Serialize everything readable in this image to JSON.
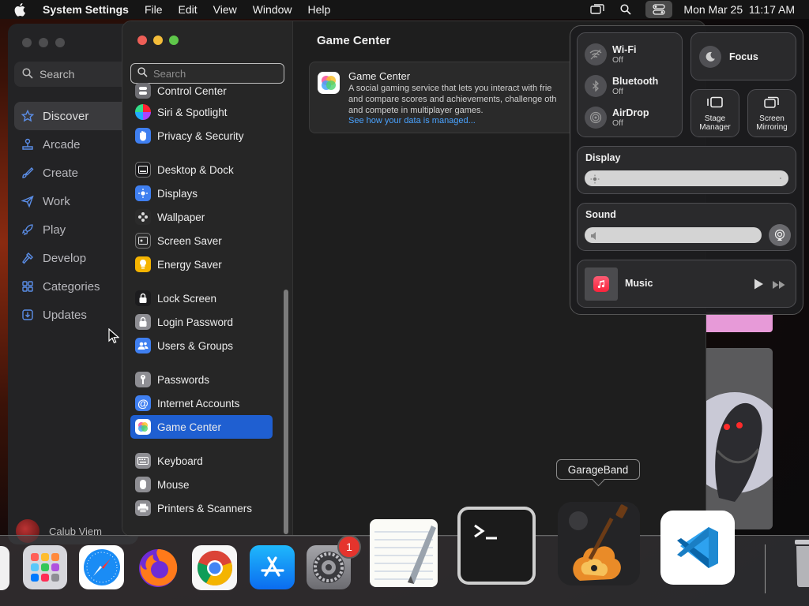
{
  "menubar": {
    "app_name": "System Settings",
    "menus": [
      "File",
      "Edit",
      "View",
      "Window",
      "Help"
    ],
    "datetime": "Mon Mar 25  11:17 AM"
  },
  "appstore": {
    "search_placeholder": "Search",
    "nav": [
      {
        "label": "Discover",
        "icon": "star-icon",
        "active": true
      },
      {
        "label": "Arcade",
        "icon": "joystick-icon"
      },
      {
        "label": "Create",
        "icon": "brush-icon"
      },
      {
        "label": "Work",
        "icon": "paperplane-icon"
      },
      {
        "label": "Play",
        "icon": "rocket-icon"
      },
      {
        "label": "Develop",
        "icon": "hammer-icon"
      },
      {
        "label": "Categories",
        "icon": "grid-icon"
      },
      {
        "label": "Updates",
        "icon": "download-icon"
      }
    ],
    "user_name": "Calub Viem"
  },
  "settings": {
    "search_placeholder": "Search",
    "sidebar": [
      {
        "label": "Control Center",
        "color": "#6e6e73"
      },
      {
        "label": "Siri & Spotlight",
        "color": "#a64de0"
      },
      {
        "label": "Privacy & Security",
        "color": "#3f7ff0"
      },
      {
        "label": "Desktop & Dock",
        "color": "#1c1c1e"
      },
      {
        "label": "Displays",
        "color": "#3f7ff0"
      },
      {
        "label": "Wallpaper",
        "color": "#2b8fe8"
      },
      {
        "label": "Screen Saver",
        "color": "#46c2f0"
      },
      {
        "label": "Energy Saver",
        "color": "#f5b400"
      },
      {
        "label": "Lock Screen",
        "color": "#1c1c1e"
      },
      {
        "label": "Login Password",
        "color": "#8e8e93"
      },
      {
        "label": "Users & Groups",
        "color": "#3f7ff0"
      },
      {
        "label": "Passwords",
        "color": "#8e8e93"
      },
      {
        "label": "Internet Accounts",
        "color": "#3f7ff0"
      },
      {
        "label": "Game Center",
        "color": "#ffffff",
        "selected": true
      },
      {
        "label": "Keyboard",
        "color": "#8e8e93"
      },
      {
        "label": "Mouse",
        "color": "#8e8e93"
      },
      {
        "label": "Printers & Scanners",
        "color": "#8e8e93"
      }
    ],
    "content": {
      "title": "Game Center",
      "card_title": "Game Center",
      "description_lines": [
        "A social gaming service that lets you interact with frie",
        "and compare scores and achievements, challenge oth",
        "and compete in multiplayer games."
      ],
      "link": "See how your data is managed..."
    }
  },
  "control_center": {
    "wifi": {
      "label": "Wi-Fi",
      "status": "Off"
    },
    "bluetooth": {
      "label": "Bluetooth",
      "status": "Off"
    },
    "airdrop": {
      "label": "AirDrop",
      "status": "Off"
    },
    "focus": "Focus",
    "stage_manager": [
      "Stage",
      "Manager"
    ],
    "screen_mirroring": [
      "Screen",
      "Mirroring"
    ],
    "display_label": "Display",
    "sound_label": "Sound",
    "music_label": "Music"
  },
  "dock": {
    "tooltip": "GarageBand",
    "settings_badge": "1"
  }
}
